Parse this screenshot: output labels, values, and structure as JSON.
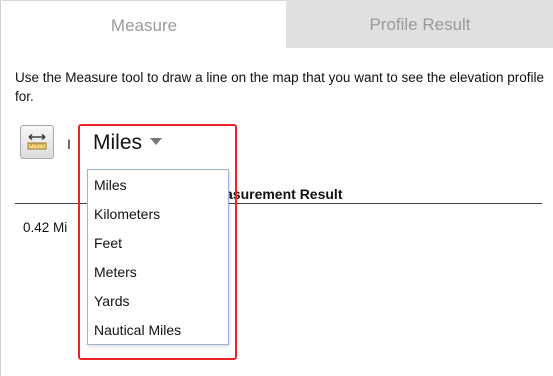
{
  "tabs": [
    {
      "label": "Measure",
      "active": true
    },
    {
      "label": "Profile Result",
      "active": false
    }
  ],
  "instructions": "Use the Measure tool to draw a line on the map that you want to see the elevation profile for.",
  "tool_button": {
    "icon": "ruler-distance-icon"
  },
  "left_stub": "I",
  "units_select": {
    "selected": "Miles"
  },
  "units_options": [
    "Miles",
    "Kilometers",
    "Feet",
    "Meters",
    "Yards",
    "Nautical Miles"
  ],
  "result": {
    "header": "asurement Result",
    "value": "0.42 Mi"
  },
  "colors": {
    "highlight": "#e8252a",
    "inactive_tab": "#e0e0e0",
    "tab_text": "#9a9a9a"
  }
}
